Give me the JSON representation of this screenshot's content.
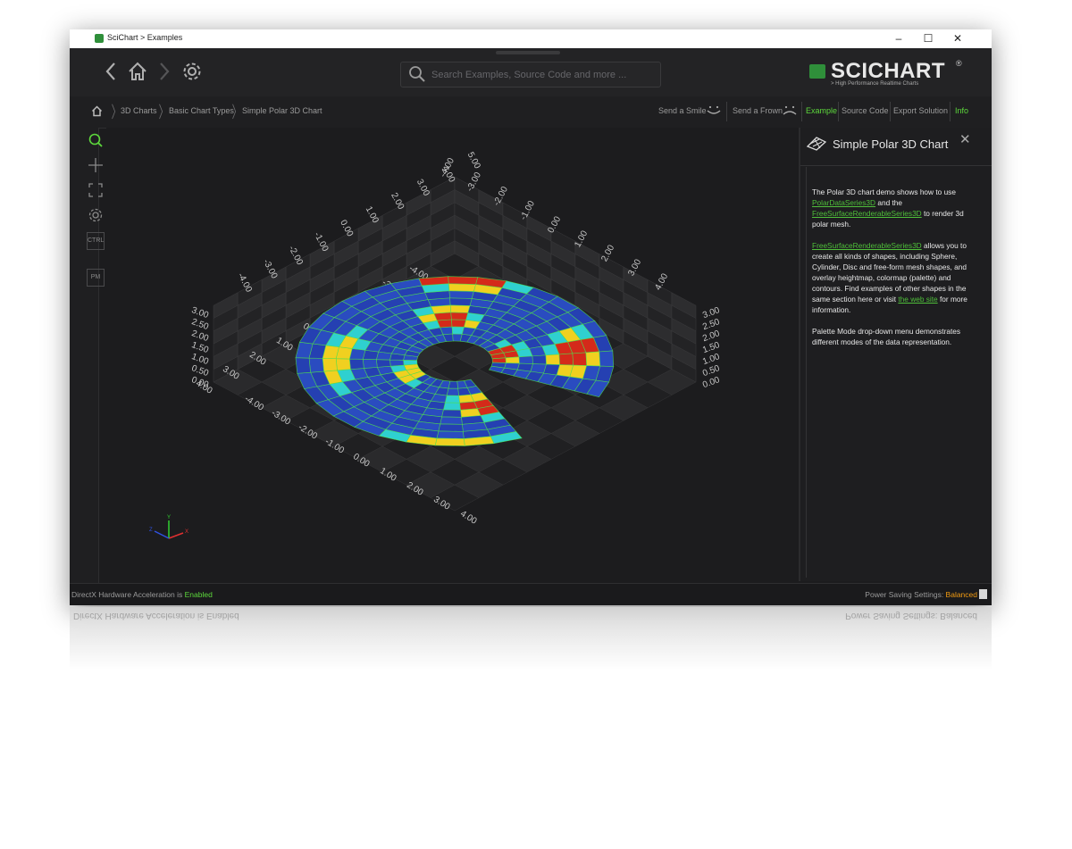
{
  "window": {
    "title": "SciChart > Examples",
    "controls": {
      "minimize": "–",
      "maximize": "☐",
      "close": "✕"
    }
  },
  "toolbar": {
    "back_icon": "chevron-left-icon",
    "home_icon": "home-icon",
    "forward_icon": "chevron-right-icon",
    "settings_icon": "gear-icon",
    "search_placeholder": "Search Examples, Source Code and more ...",
    "brand_name": "SCICHART",
    "brand_registered": "®",
    "brand_tagline": "> High Performance Realtime Charts"
  },
  "breadcrumb": {
    "items": [
      "3D Charts",
      "Basic Chart Types",
      "Simple Polar 3D Chart"
    ],
    "send_smile": "Send a Smile",
    "send_frown": "Send a Frown",
    "tabs": [
      "Example",
      "Source Code",
      "Export Solution",
      "Info"
    ],
    "active_tab": "Example"
  },
  "side_tools": {
    "ctrl": "CTRL",
    "pm": "PM"
  },
  "chart": {
    "axis_labels_a": [
      "-4.00",
      "-3.00",
      "-2.00",
      "-1.00",
      "0.00",
      "1.00",
      "2.00",
      "3.00",
      "4.00"
    ],
    "axis_labels_b": [
      "5.00",
      "4.00",
      "3.00",
      "2.00",
      "1.00",
      "0.00",
      "-1.00",
      "-2.00",
      "-3.00",
      "-4.00"
    ],
    "axis_labels_x_front": [
      "4.00",
      "3.00",
      "2.00",
      "1.00",
      "0.00",
      "-1.00",
      "-2.00",
      "-3.00",
      "-4.00"
    ],
    "axis_labels_z_front": [
      "4.00",
      "3.00",
      "2.00",
      "1.00",
      "0.00",
      "-1.00",
      "-2.00",
      "-3.00",
      "-4.00"
    ],
    "axis_labels_y_left": [
      "3.00",
      "2.50",
      "2.00",
      "1.50",
      "1.00",
      "0.50",
      "0.00"
    ],
    "axis_labels_y_right": [
      "3.00",
      "2.50",
      "2.00",
      "1.50",
      "1.00",
      "0.50",
      "0.00"
    ],
    "gizmo": {
      "x": "X",
      "y": "Y",
      "z": "Z"
    },
    "colors": {
      "low": "#1f3fa8",
      "mid": "#2fd0d0",
      "high": "#d42a1a",
      "grid": "#4de04d"
    }
  },
  "info_panel": {
    "title": "Simple Polar 3D Chart",
    "close": "✕",
    "p1_text1": "The Polar 3D chart demo shows how to use ",
    "p1_link1": "PolarDataSeries3D",
    "p1_text2": " and the ",
    "p1_link2": "FreeSurfaceRenderableSeries3D",
    "p1_text3": " to render 3d polar mesh.",
    "p2_link1": "FreeSurfaceRenderableSeries3D",
    "p2_text1": " allows you to create all kinds of shapes, including Sphere, Cylinder, Disc and free-form mesh shapes, and overlay heightmap, colormap (palette) and contours. Find examples of other shapes in the same section here or visit ",
    "p2_link2": "the web site",
    "p2_text2": " for more information.",
    "p3_text": "Palette Mode drop-down menu demonstrates different modes of the data representation."
  },
  "status": {
    "left_prefix": "DirectX Hardware Acceleration is ",
    "left_value": "Enabled",
    "right_prefix": "Power Saving Settings: ",
    "right_value": "Balanced"
  }
}
